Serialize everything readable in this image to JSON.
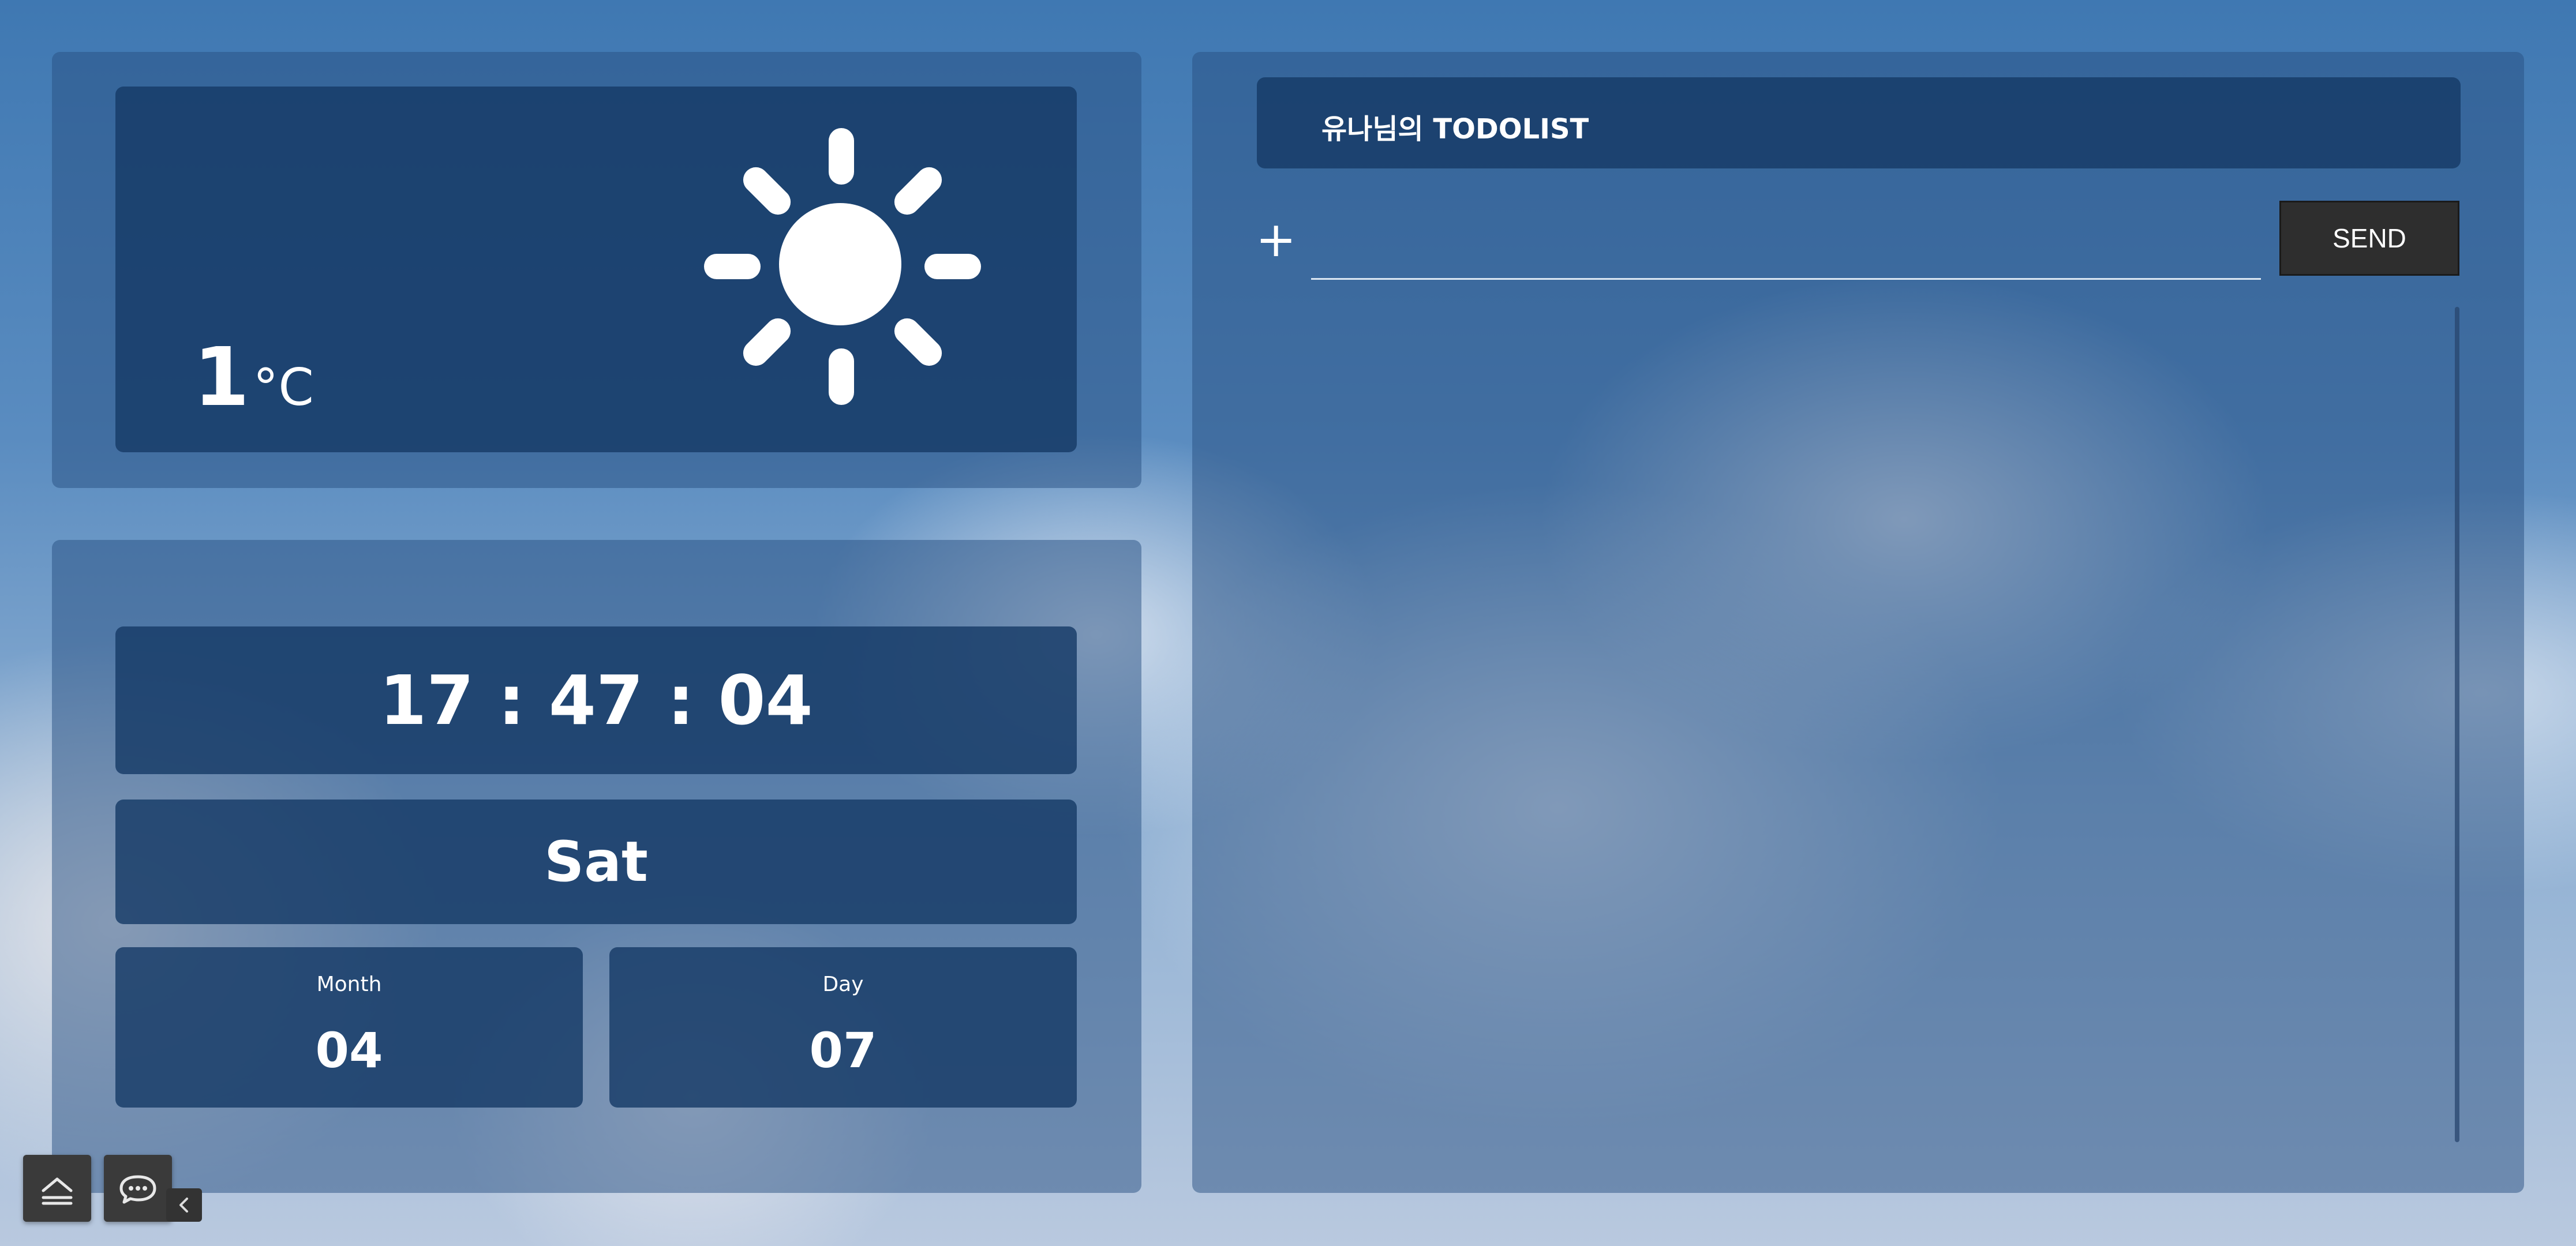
{
  "weather": {
    "temperature": "1",
    "unit": "°C",
    "icon": "sun-icon"
  },
  "clock": {
    "time": "17 : 47 : 04",
    "weekday": "Sat",
    "month_label": "Month",
    "month_value": "04",
    "day_label": "Day",
    "day_value": "07"
  },
  "todo": {
    "title": "유나님의 TODOLIST",
    "add_icon": "+",
    "input_value": "",
    "input_placeholder": "",
    "send_label": "SEND",
    "items": []
  },
  "dock": {
    "home_icon": "home-icon",
    "chat_icon": "chat-icon",
    "collapse_icon": "chevron-left-icon"
  },
  "colors": {
    "panel": "#28507f",
    "card": "#163a66",
    "send_button": "#2e2e2e",
    "text": "#ffffff"
  }
}
